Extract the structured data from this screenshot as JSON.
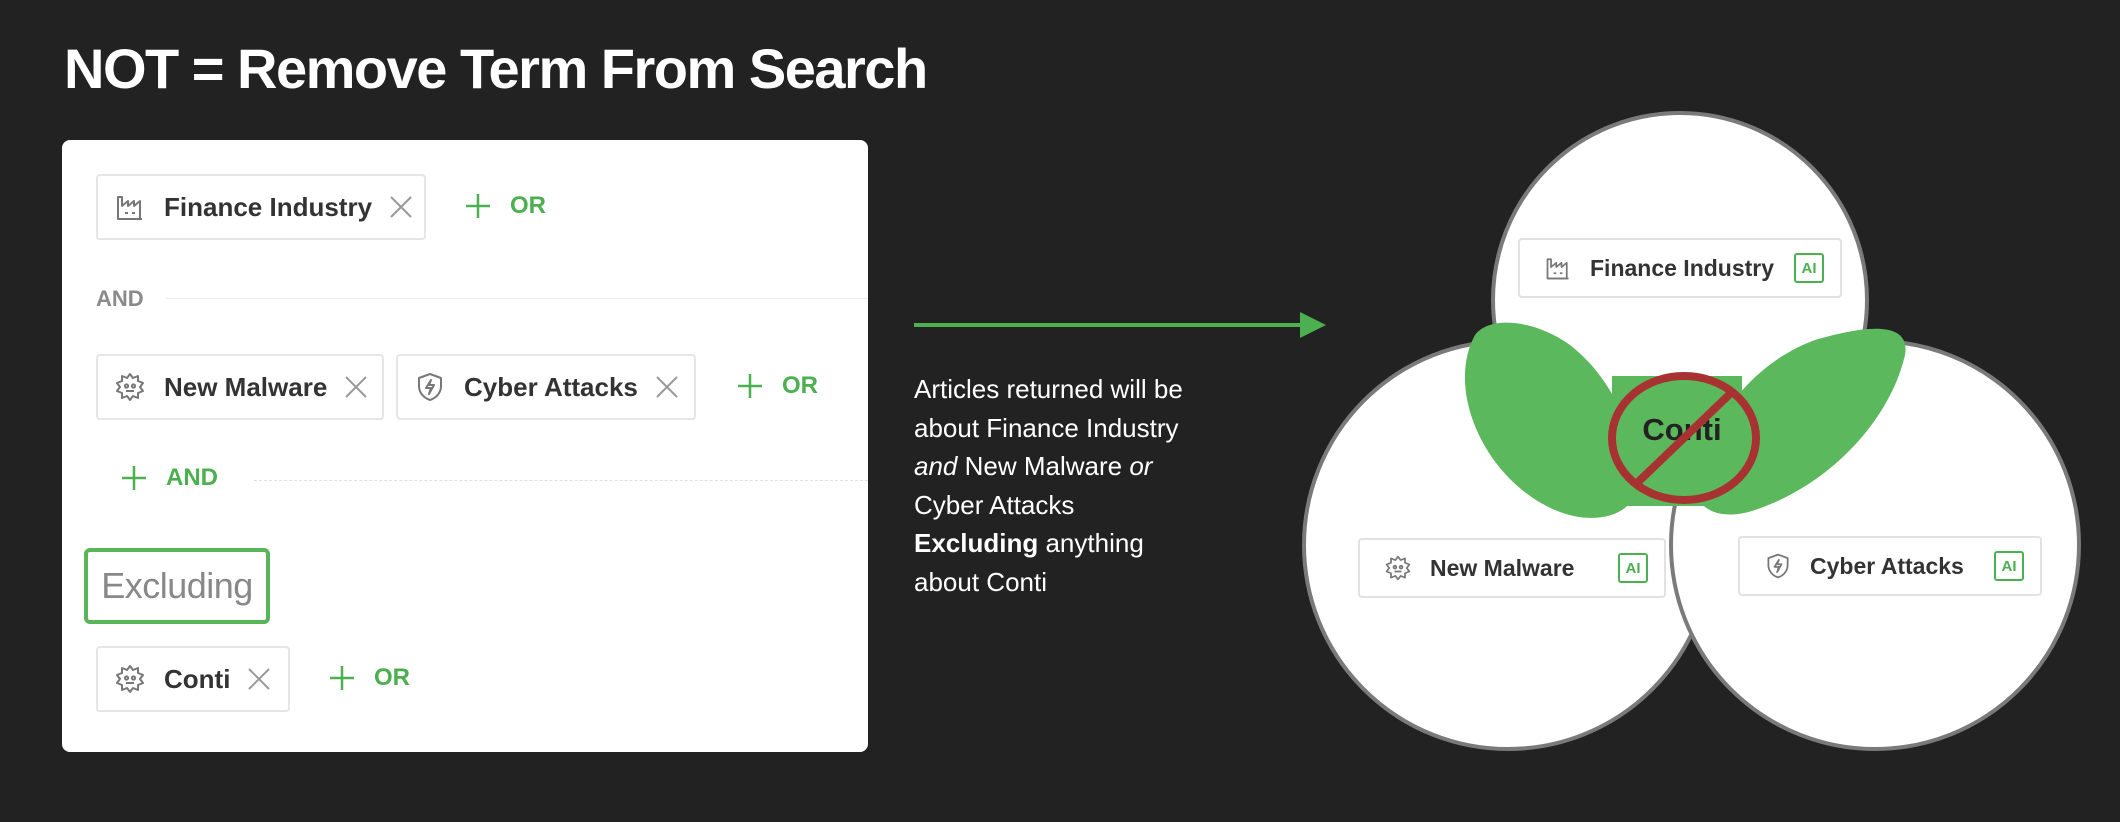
{
  "title": "NOT = Remove Term From Search",
  "builder": {
    "group1": {
      "tags": [
        {
          "label": "Finance Industry",
          "icon": "industry-icon"
        }
      ],
      "or_label": "OR"
    },
    "and_label": "AND",
    "group2": {
      "tags": [
        {
          "label": "New Malware",
          "icon": "malware-icon"
        },
        {
          "label": "Cyber Attacks",
          "icon": "shield-icon"
        }
      ],
      "or_label": "OR"
    },
    "add_and_label": "AND",
    "excluding_label": "Excluding",
    "excluded": {
      "tags": [
        {
          "label": "Conti",
          "icon": "malware-icon"
        }
      ],
      "or_label": "OR"
    }
  },
  "description": {
    "line1": "Articles returned will be",
    "line2": "about Finance Industry",
    "and_word": "and",
    "line3_rest": " New Malware ",
    "or_word": "or",
    "line4": "Cyber Attacks",
    "excluding_word": "Excluding",
    "line5_rest": " anything",
    "line6": "about Conti"
  },
  "venn": {
    "top": {
      "label": "Finance Industry",
      "badge": "AI"
    },
    "left": {
      "label": "New Malware",
      "badge": "AI"
    },
    "right": {
      "label": "Cyber Attacks",
      "badge": "AI"
    },
    "excluded_center": "Conti"
  },
  "colors": {
    "background": "#222222",
    "accent_green": "#4caf50",
    "highlight_green": "#5cb85c",
    "ban_red": "#a83232"
  }
}
